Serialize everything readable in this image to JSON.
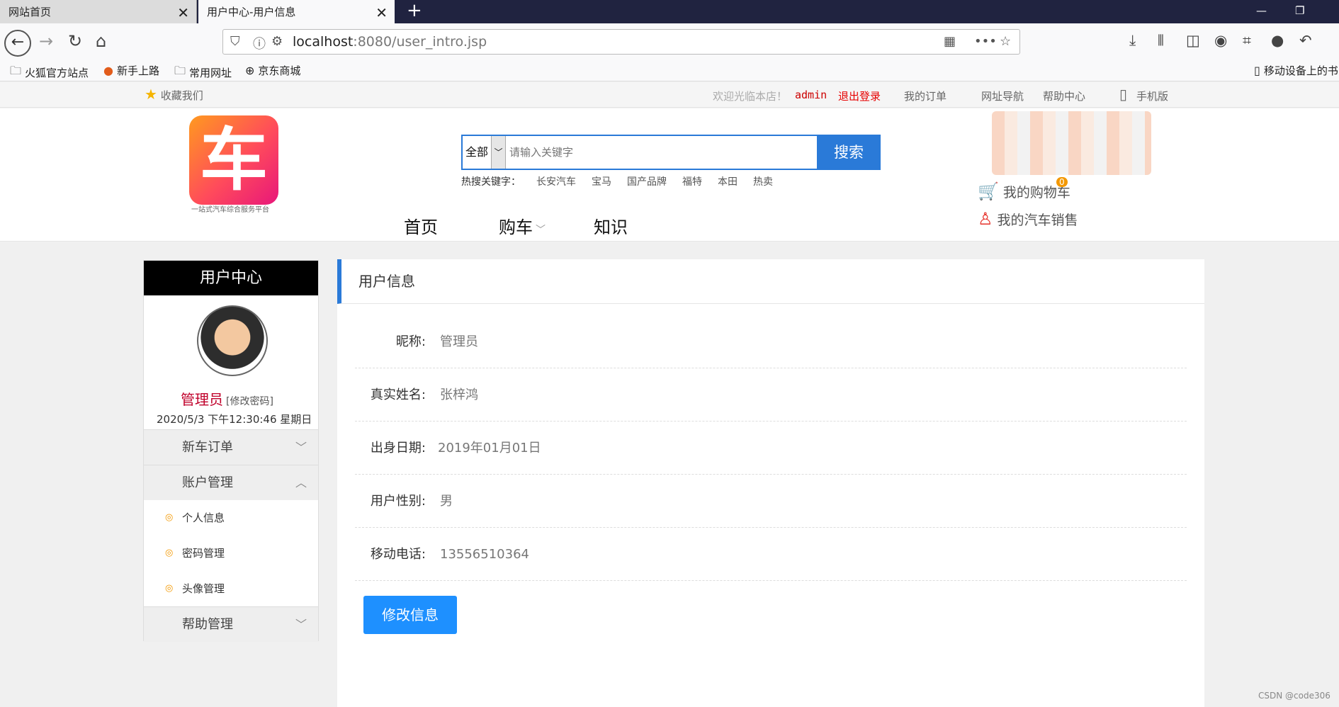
{
  "browser": {
    "tabs": [
      {
        "label": "网站首页"
      },
      {
        "label": "用户中心-用户信息"
      }
    ],
    "url_host": "localhost",
    "url_rest": ":8080/user_intro.jsp",
    "bookmarks": [
      "火狐官方站点",
      "新手上路",
      "常用网址",
      "京东商城"
    ],
    "mobile_bookmarks": "移动设备上的书"
  },
  "topbar": {
    "favorite": "收藏我们",
    "welcome": "欢迎光临本店！",
    "user": "admin",
    "logout": "退出登录",
    "orders": "我的订单",
    "site_nav": "网址导航",
    "help": "帮助中心",
    "mobile": "手机版"
  },
  "header": {
    "logo_char": "车",
    "logo_sub": "一站式汽车综合服务平台",
    "search_category": "全部",
    "search_placeholder": "请输入关键字",
    "search_button": "搜索",
    "hot_label": "热搜关键字：",
    "hot_keywords": [
      "长安汽车",
      "宝马",
      "国产品牌",
      "福特",
      "本田",
      "热卖"
    ],
    "nav": [
      "首页",
      "购车",
      "知识"
    ],
    "cart": "我的购物车",
    "cart_count": "0",
    "sales": "我的汽车销售"
  },
  "sidebar": {
    "title": "用户中心",
    "name": "管理员",
    "change_pwd": "[修改密码]",
    "datetime": "2020/5/3 下午12:30:46 星期日",
    "menus": [
      {
        "label": "新车订单"
      },
      {
        "label": "账户管理"
      },
      {
        "label": "帮助管理"
      }
    ],
    "sub_items": [
      "个人信息",
      "密码管理",
      "头像管理"
    ]
  },
  "panel": {
    "title": "用户信息",
    "fields": [
      {
        "label": "昵称:",
        "value": "管理员"
      },
      {
        "label": "真实姓名:",
        "value": "张梓鸿"
      },
      {
        "label": "出身日期:",
        "value": "2019年01月01日"
      },
      {
        "label": "用户性别:",
        "value": "男"
      },
      {
        "label": "移动电话:",
        "value": "13556510364"
      }
    ],
    "edit_button": "修改信息"
  },
  "watermark": "CSDN @code306"
}
